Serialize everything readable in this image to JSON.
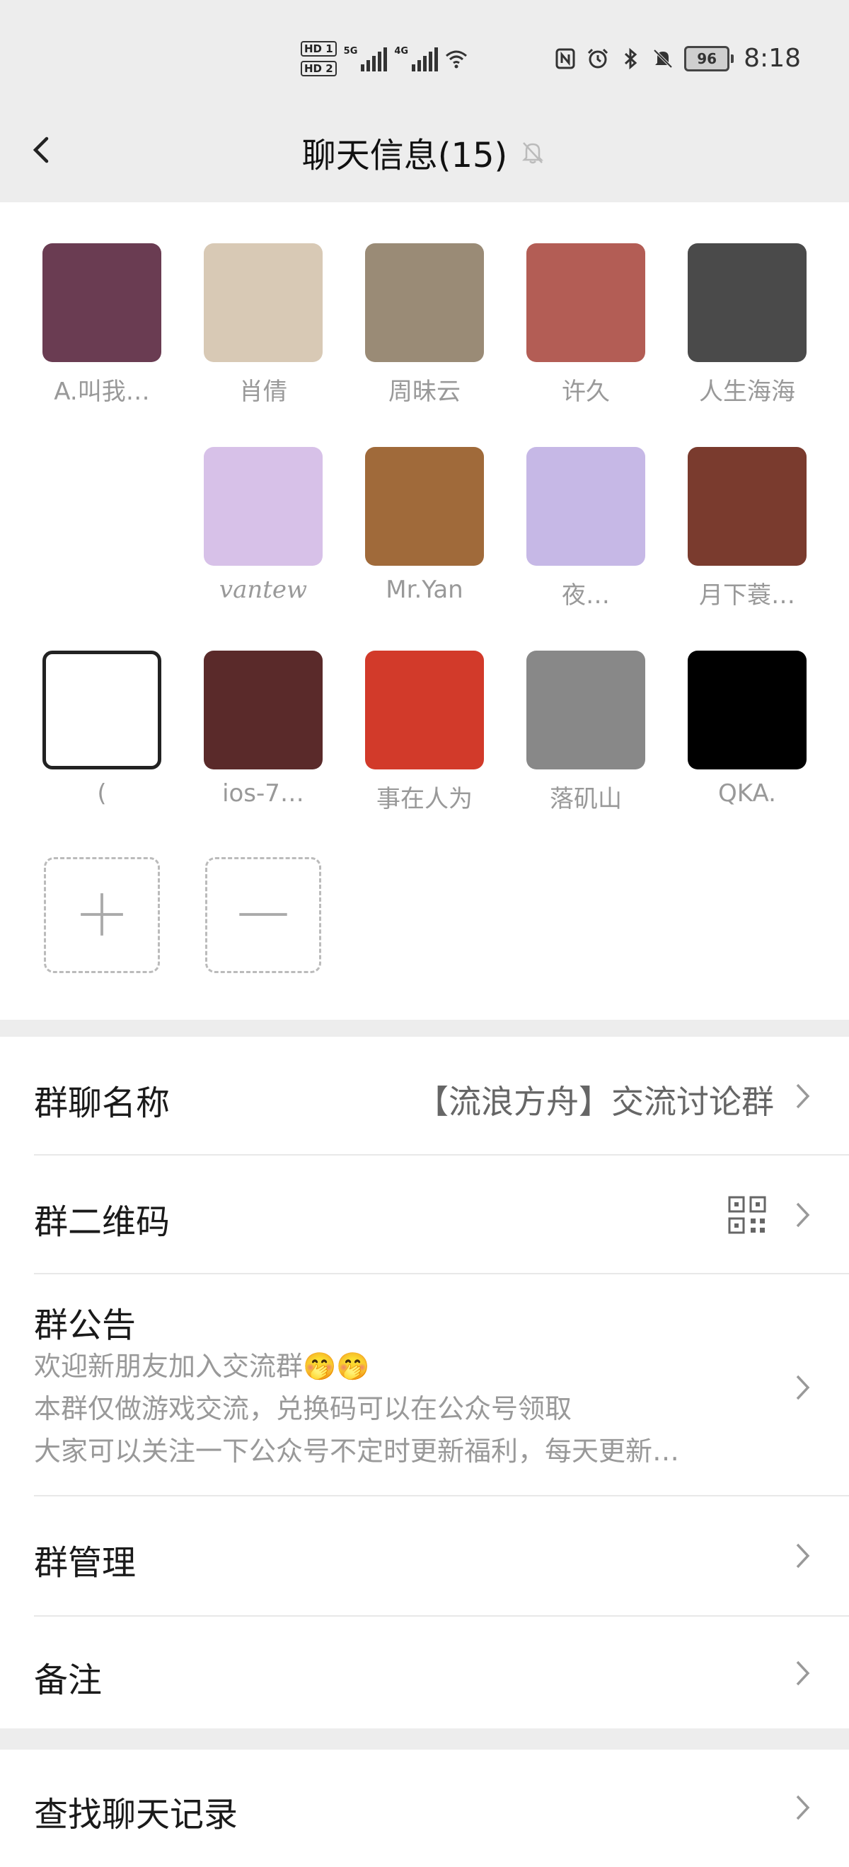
{
  "status_bar": {
    "hd_labels": [
      "HD 1",
      "HD 2"
    ],
    "network_labels": [
      "5G",
      "4G"
    ],
    "battery": "96",
    "time": "8:18"
  },
  "nav": {
    "title": "聊天信息(15)"
  },
  "members": [
    {
      "name": "A.叫我…",
      "avatar_color": "#6a3c52"
    },
    {
      "name": "肖倩",
      "avatar_color": "#d8c9b5"
    },
    {
      "name": "周昧云",
      "avatar_color": "#9a8b76"
    },
    {
      "name": "许久",
      "avatar_color": "#b35d55"
    },
    {
      "name": "人生海海",
      "avatar_color": "#4a4a4a"
    },
    {
      "name": "vantew",
      "avatar_color": "#d7c1e8"
    },
    {
      "name": "Mr.Yan",
      "avatar_color": "#a06a3a"
    },
    {
      "name": "夜…",
      "avatar_color": "#c6b8e6"
    },
    {
      "name": "月下蓑…",
      "avatar_color": "#7a3b2e"
    },
    {
      "name": "(",
      "avatar_color": "#ffffff"
    },
    {
      "name": "ios-7…",
      "avatar_color": "#5a2a2a"
    },
    {
      "name": "事在人为",
      "avatar_color": "#d23a2a"
    },
    {
      "name": "落矶山",
      "avatar_color": "#888888"
    },
    {
      "name": "QKA.",
      "avatar_color": "#000000"
    }
  ],
  "member_actions": {
    "add_icon": "plus-icon",
    "remove_icon": "minus-icon"
  },
  "settings": {
    "group_name_label": "群聊名称",
    "group_name_value": "【流浪方舟】交流讨论群",
    "qr_label": "群二维码",
    "notice_label": "群公告",
    "notice_lines": [
      "欢迎新朋友加入交流群🤭🤭",
      "本群仅做游戏交流，兑换码可以在公众号领取",
      "大家可以关注一下公众号不定时更新福利，每天更新…"
    ],
    "manage_label": "群管理",
    "remark_label": "备注",
    "search_label": "查找聊天记录"
  }
}
